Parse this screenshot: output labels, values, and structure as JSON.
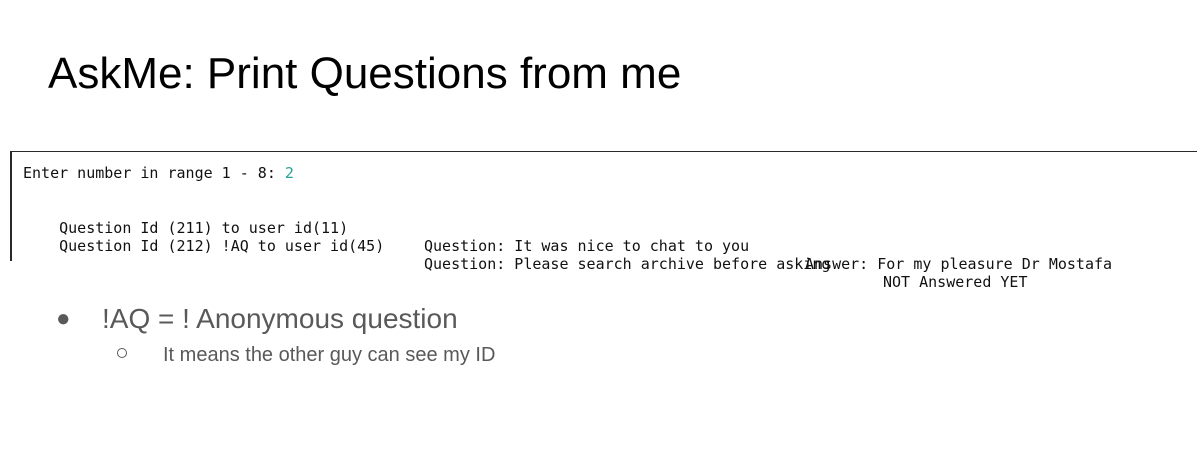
{
  "slide": {
    "title": "AskMe: Print Questions from me"
  },
  "terminal": {
    "prompt": "Enter number in range 1 - 8: ",
    "input_value": "2",
    "input_color": "#2aa198",
    "rows": [
      {
        "id_text": "Question Id (211) to user id(11)",
        "question_text": "Question: It was nice to chat to you",
        "answer_text": "Answer: For my pleasure Dr Mostafa"
      },
      {
        "id_text": "Question Id (212) !AQ to user id(45)",
        "question_text": "Question: Please search archive before asking",
        "answer_text": "NOT Answered YET"
      }
    ]
  },
  "bullets": {
    "level1": "!AQ = ! Anonymous question",
    "level2": "It means the other guy can see my ID"
  }
}
